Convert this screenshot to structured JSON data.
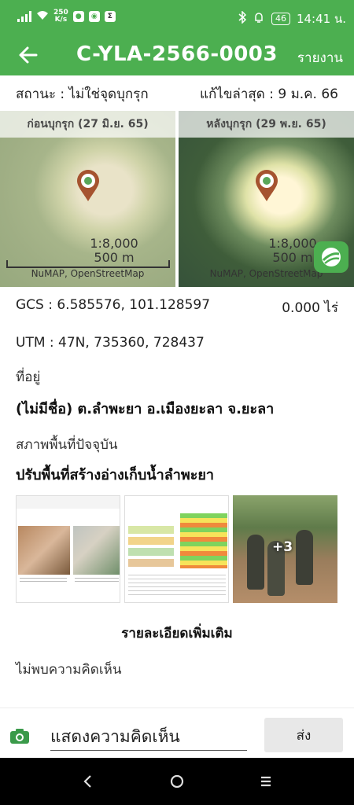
{
  "status_bar": {
    "speed_top": "250",
    "speed_bottom": "K/s",
    "battery": "46",
    "time": "14:41 น."
  },
  "app_bar": {
    "title": "C-YLA-2566-0003",
    "report_label": "รายงาน"
  },
  "status_row": {
    "status": "สถานะ : ไม่ใช่จุดบุกรุก",
    "last_edited": "แก้ไขล่าสุด : 9 ม.ค. 66"
  },
  "maps": [
    {
      "caption": "ก่อนบุกรุก (27 มิ.ย. 65)",
      "scale": "1:8,000",
      "distance": "500 m",
      "attribution": "NuMAP, OpenStreetMap"
    },
    {
      "caption": "หลังบุกรุก (29 พ.ย. 65)",
      "scale": "1:8,000",
      "distance": "500 m",
      "attribution": "NuMAP, OpenStreetMap"
    }
  ],
  "info": {
    "gcs": "GCS : 6.585576, 101.128597",
    "area": "0.000 ไร่",
    "utm": "UTM : 47N, 735360, 728437",
    "address_label": "ที่อยู่",
    "address_value": "(ไม่มีชื่อ) ต.ลำพะยา อ.เมืองยะลา จ.ยะลา",
    "land_label": "สภาพพื้นที่ปัจจุบัน",
    "land_value": "ปรับพื้นที่สร้างอ่างเก็บน้ำลำพะยา"
  },
  "photos": {
    "extra_count": "+3"
  },
  "more_details": "รายละเอียดเพิ่มเติม",
  "no_comment": "ไม่พบความคิดเห็น",
  "comment": {
    "placeholder": "แสดงความคิดเห็น",
    "send_label": "ส่ง"
  },
  "colors": {
    "brand": "#4caf50"
  }
}
